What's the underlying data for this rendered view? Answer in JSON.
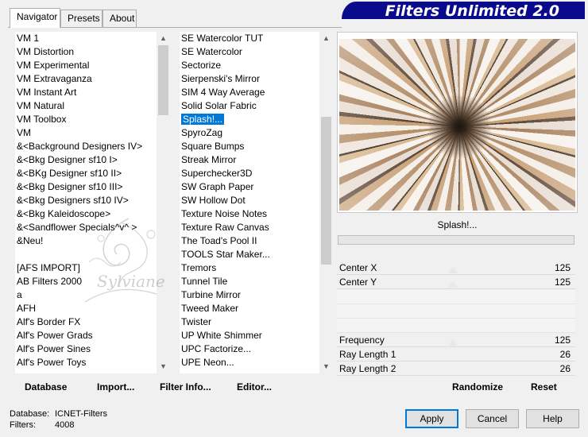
{
  "tabs": [
    {
      "label": "Navigator"
    },
    {
      "label": "Presets"
    },
    {
      "label": "About"
    }
  ],
  "banner": {
    "title": "Filters Unlimited 2.0"
  },
  "categories": [
    "VM 1",
    "VM Distortion",
    "VM Experimental",
    "VM Extravaganza",
    "VM Instant Art",
    "VM Natural",
    "VM Toolbox",
    "VM",
    "&<Background Designers IV>",
    "&<Bkg Designer sf10 I>",
    "&<BKg Designer sf10 II>",
    "&<Bkg Designer sf10 III>",
    "&<Bkg Designers sf10 IV>",
    "&<Bkg Kaleidoscope>",
    "&<Sandflower Specials^v^ >",
    "&Neu!",
    "",
    "[AFS IMPORT]",
    "AB Filters 2000",
    "a",
    "AFH",
    "Alf's Border FX",
    "Alf's Power Grads",
    "Alf's Power Sines",
    "Alf's Power Toys"
  ],
  "filters": [
    "SE Watercolor TUT",
    "SE Watercolor",
    "Sectorize",
    "Sierpenski's Mirror",
    "SIM 4 Way Average",
    "Solid Solar Fabric",
    "Splash!...",
    "SpyroZag",
    "Square Bumps",
    "Streak Mirror",
    "Superchecker3D",
    "SW Graph Paper",
    "SW Hollow Dot",
    "Texture Noise Notes",
    "Texture Raw Canvas",
    "The Toad's Pool II",
    "TOOLS Star Maker...",
    "Tremors",
    "Tunnel Tile",
    "Turbine Mirror",
    "Tweed Maker",
    "Twister",
    "UP White Shimmer",
    "UPC Factorize...",
    "UPE Neon..."
  ],
  "selected_filter": "Splash!...",
  "selected_filter_index": 6,
  "filter_name": "Splash!...",
  "params": [
    {
      "label": "Center X",
      "value": "125"
    },
    {
      "label": "Center Y",
      "value": "125"
    },
    {
      "label": "Frequency",
      "value": "125"
    },
    {
      "label": "Ray Length 1",
      "value": "26"
    },
    {
      "label": "Ray Length 2",
      "value": "26"
    }
  ],
  "bottom_links": {
    "database": "Database",
    "import": "Import...",
    "filter_info": "Filter Info...",
    "editor": "Editor...",
    "randomize": "Randomize",
    "reset": "Reset"
  },
  "info": {
    "database_label": "Database:",
    "database_value": "ICNET-Filters",
    "filters_label": "Filters:",
    "filters_value": "4008"
  },
  "buttons": {
    "apply": "Apply",
    "cancel": "Cancel",
    "help": "Help"
  },
  "watermark": "Sylviane",
  "colors": {
    "banner": "#0a0a8c",
    "selection": "#0078d7"
  }
}
